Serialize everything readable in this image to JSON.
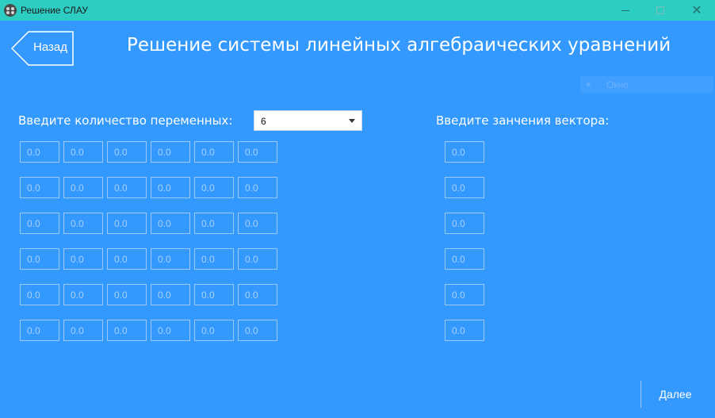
{
  "window": {
    "title": "Решение СЛАУ",
    "icon": "app-icon",
    "close_glyph": "✕"
  },
  "header": {
    "back_label": "Назад",
    "title": "Решение системы линейных алгебраических уравнений"
  },
  "window_tag": {
    "label": "Окно"
  },
  "variables": {
    "label": "Введите количество переменных:",
    "selected_count": "6"
  },
  "vector": {
    "label": "Введите занчения вектора:"
  },
  "matrix": {
    "placeholder": "0.0",
    "rows": 6,
    "cols": 6
  },
  "vector_values": {
    "placeholder": "0.0",
    "rows": 6
  },
  "footer": {
    "next_label": "Далее"
  },
  "colors": {
    "background": "#3399ff",
    "titlebar": "#2ecdc4",
    "cell_border": "#9ec9f7"
  }
}
